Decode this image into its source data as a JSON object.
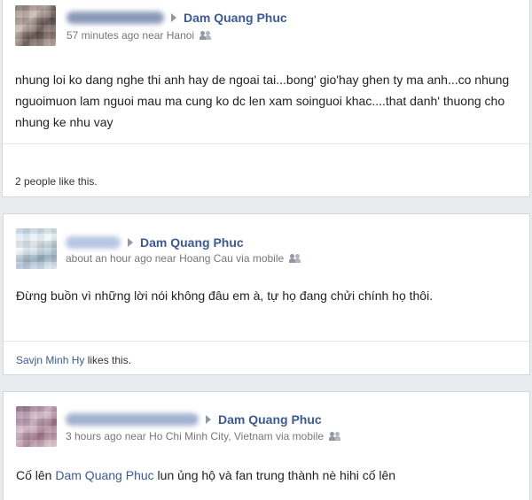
{
  "posts": [
    {
      "author_name": "Dam Quang Phuc",
      "meta": "57 minutes ago near Hanoi",
      "content": "nhung loi ko dang nghe thi anh hay de ngoai tai...bong' gio'hay ghen ty ma anh...co nhung nguoimuon lam nguoi mau ma cung ko dc len xam soinguoi khac....that danh' thuong cho nhung ke nhu vay",
      "likes": "2 people like this."
    },
    {
      "author_name": "Dam Quang Phuc",
      "meta": "about an hour ago near Hoang Cau via mobile",
      "content": "Đừng buồn vì những lời nói không đâu em à, tự họ đang chửi chính họ thôi.",
      "likes_name": "Savjn Minh Hy",
      "likes_suffix": " likes this."
    },
    {
      "author_name": "Dam Quang Phuc",
      "meta": "3 hours ago near Ho Chi Minh City, Vietnam via mobile",
      "content_prefix": "Cố lên ",
      "content_link": "Dam Quang Phuc",
      "content_suffix": " lun ủng hộ và fan trung thành nè hihi cố lên"
    }
  ],
  "icons": {
    "privacy": "friends-icon",
    "target": "triangle-right-icon"
  }
}
